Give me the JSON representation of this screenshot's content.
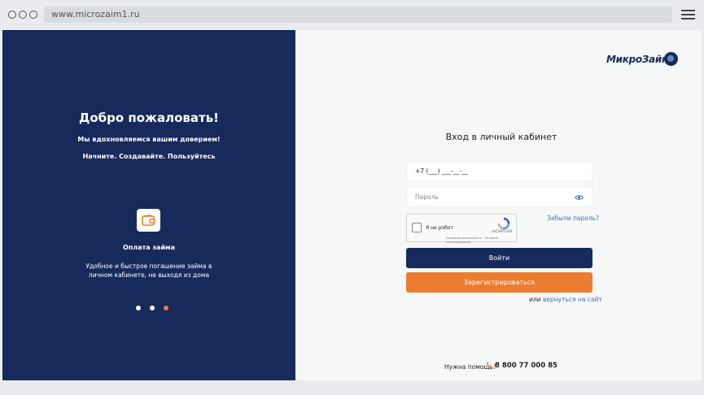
{
  "browser": {
    "url": "www.microzaim1.ru"
  },
  "welcome": {
    "title": "Добро пожаловать!",
    "subtitle": "Мы вдохновляемся вашим доверием!",
    "tagline": "Начните. Создавайте. Пользуйтесь"
  },
  "feature": {
    "icon": "wallet-icon",
    "title": "Оплата займа",
    "description": "Удобное и быстрое погашение займа в личном кабинете, не выходя из дома"
  },
  "pager": {
    "count": 3,
    "active_index": 2
  },
  "logo": {
    "text": "МикроЗайм"
  },
  "login_form": {
    "title": "Вход в личный кабинет",
    "phone_value": "+7 (___) ___-__-__",
    "password_placeholder": "Пароль",
    "forgot_label": "Забыли пароль?",
    "captcha_label": "Я не робот",
    "captcha_brand": "reCAPTCHA",
    "captcha_links": "Конфиденциальность - Условия использования",
    "login_label": "Войти",
    "register_label": "Зарегистрироваться",
    "back_prefix": "или",
    "back_link": "вернуться на сайт"
  },
  "help": {
    "label": "Нужна помощь?",
    "phone": "8 800 77 000 85"
  },
  "colors": {
    "navy": "#172a5c",
    "orange": "#ec7d30",
    "link": "#3b6fbf"
  }
}
